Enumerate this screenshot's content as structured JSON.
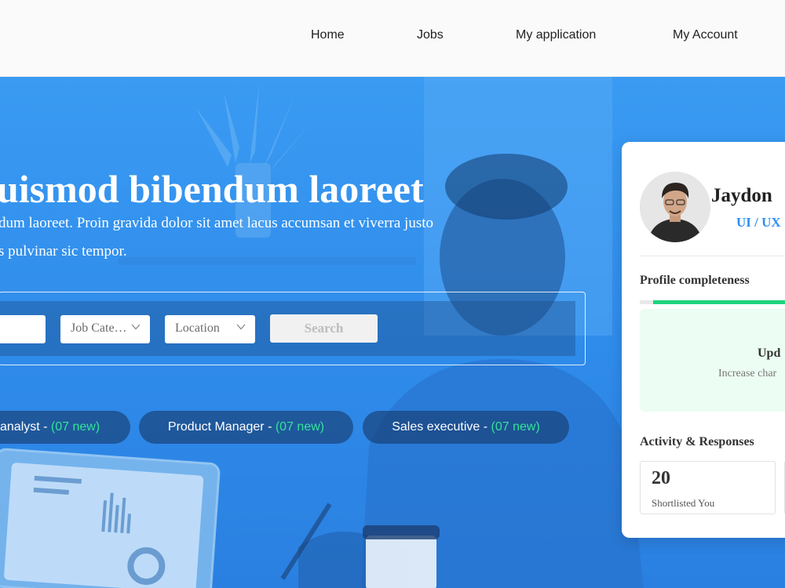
{
  "header": {
    "nav": [
      {
        "label": "Home"
      },
      {
        "label": "Jobs"
      },
      {
        "label": "My application"
      },
      {
        "label": "My Account"
      }
    ]
  },
  "hero": {
    "headline": "uismod bibendum laoreet",
    "subtext_line1": "dum laoreet. Proin gravida dolor sit amet lacus accumsan et viverra justo",
    "subtext_line2": "s pulvinar sic tempor.",
    "search": {
      "category_value": "Job Cate…",
      "location_value": "Location",
      "button_label": "Search"
    },
    "tags": [
      {
        "label": "analyst - ",
        "count": "(07 new)"
      },
      {
        "label": "Product Manager - ",
        "count": "(07 new)"
      },
      {
        "label": "Sales executive - ",
        "count": "(07 new)"
      }
    ]
  },
  "profile": {
    "name": "Jaydon",
    "role": "UI / UX",
    "completeness_title": "Profile completeness",
    "update_title": "Upd",
    "update_subtitle": "Increase char",
    "activity_title": "Activity & Responses",
    "stats": [
      {
        "value": "20",
        "label": "Shortlisted You"
      }
    ]
  },
  "colors": {
    "hero_blue": "#2f8bea",
    "accent_green": "#1fd47e",
    "tag_count_green": "#34e39a",
    "role_blue": "#2f8ff0"
  }
}
